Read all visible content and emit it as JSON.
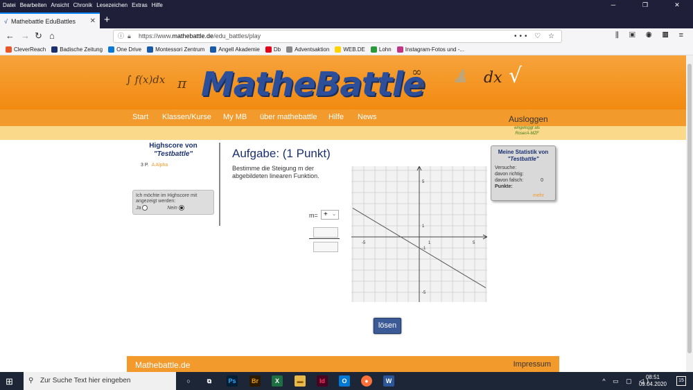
{
  "menu": [
    "Datei",
    "Bearbeiten",
    "Ansicht",
    "Chronik",
    "Lesezeichen",
    "Extras",
    "Hilfe"
  ],
  "tab": {
    "title": "Mathebattle EduBattles"
  },
  "url": {
    "prefix": "https://www.",
    "host": "mathebattle.de",
    "path": "/edu_battles/play"
  },
  "bookmarks": [
    {
      "label": "CleverReach",
      "color": "#e8562a"
    },
    {
      "label": "Badische Zeitung",
      "color": "#1a3070"
    },
    {
      "label": "One Drive",
      "color": "#0a78d4"
    },
    {
      "label": "Montessori Zentrum",
      "color": "#1a5aa8"
    },
    {
      "label": "Angell Akademie",
      "color": "#1a5aa8"
    },
    {
      "label": "Db",
      "color": "#e3001b"
    },
    {
      "label": "Adventsaktion",
      "color": "#888888"
    },
    {
      "label": "WEB.DE",
      "color": "#ffd400"
    },
    {
      "label": "Lohn",
      "color": "#2a9a3a"
    },
    {
      "label": "Instagram-Fotos und -...",
      "color": "#c13584"
    }
  ],
  "site": {
    "logo": "MatheBattle",
    "nav": [
      "Start",
      "Klassen/Kurse",
      "My MB",
      "über mathebattle",
      "Hilfe",
      "News"
    ],
    "logout": "Ausloggen",
    "logged_in_line1": "eingeloggt als",
    "logged_in_line2": "RoserA-MZF"
  },
  "highscore": {
    "title_line1": "Highscore von",
    "title_line2": "\"Testbattle\"",
    "entry_points": "3 P.",
    "entry_name": "A Alpha",
    "box_text": "Ich möchte im Highscore mit angezeigt werden:",
    "option_yes": "Ja",
    "option_no": "Nein"
  },
  "task": {
    "title": "Aufgabe: (1 Punkt)",
    "text": "Bestimme die Steigung m der abgebildeten linearen Funktion.",
    "m_label": "m=",
    "sign_value": "+"
  },
  "graph": {
    "x_ticks": [
      "-5",
      "1",
      "5"
    ],
    "y_ticks": [
      "5",
      "1",
      "-1",
      "-5"
    ],
    "line_points": [
      [
        -6,
        2.6
      ],
      [
        6,
        -4.6
      ]
    ]
  },
  "stats": {
    "title_line1": "Meine Statistik von",
    "title_line2": "\"Testbattle\"",
    "tries_label": "Versuche:",
    "tries_value": "",
    "right_label": "davon richtig:",
    "right_value": "",
    "wrong_label": "davon falsch:",
    "wrong_value": "0",
    "points_label": "Punkte:",
    "points_value": "",
    "more": "mehr"
  },
  "button": {
    "solve": "lösen"
  },
  "footer": {
    "left": "Mathebattle.de",
    "right": "Impressum"
  },
  "taskbar": {
    "search_placeholder": "Zur Suche Text hier eingeben",
    "time": "08:51",
    "date": "09.04.2020",
    "notifications": "15"
  }
}
